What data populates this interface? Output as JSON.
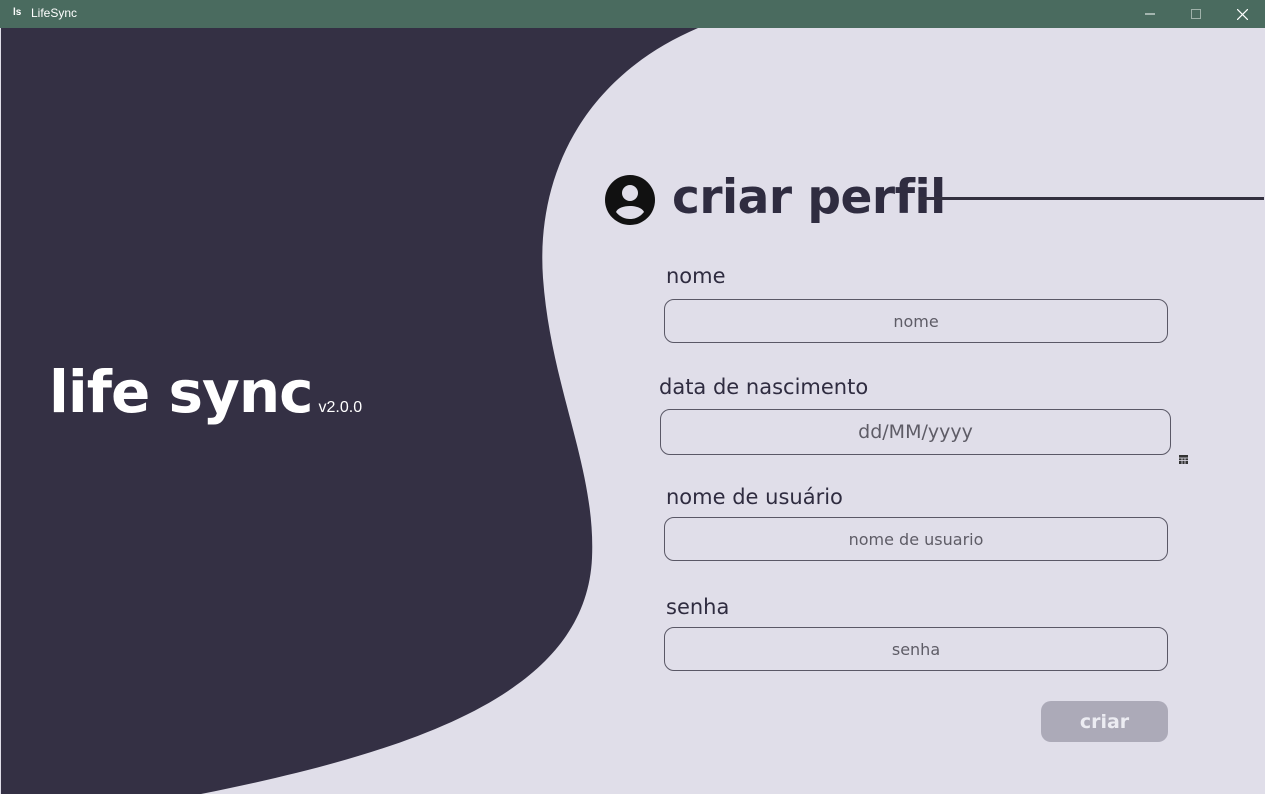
{
  "window": {
    "app_icon_text": "ls",
    "title": "LifeSync"
  },
  "brand": {
    "name": "life sync",
    "version": "v2.0.0"
  },
  "header": {
    "title": "criar perfil"
  },
  "form": {
    "name": {
      "label": "nome",
      "placeholder": "nome"
    },
    "birthdate": {
      "label": "data de nascimento",
      "placeholder": "dd/MM/yyyy"
    },
    "username": {
      "label": "nome de usuário",
      "placeholder": "nome de usuario"
    },
    "password": {
      "label": "senha",
      "placeholder": "senha"
    },
    "submit_label": "criar"
  },
  "colors": {
    "titlebar": "#4a6b5f",
    "dark_panel": "#343044",
    "background": "#e0dee9",
    "button": "#acaab8"
  },
  "icons": [
    "app-icon",
    "minimize-icon",
    "maximize-icon",
    "close-icon",
    "user-circle-icon",
    "calendar-icon"
  ]
}
